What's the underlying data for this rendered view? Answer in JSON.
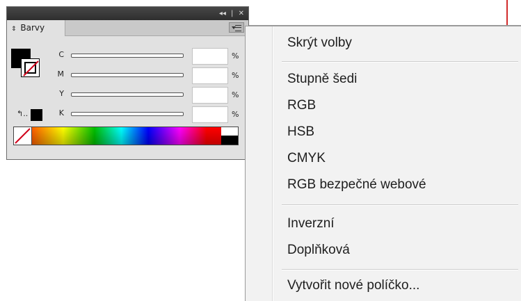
{
  "panel": {
    "tab_label": "Barvy",
    "titlebar_buttons": [
      "◂◂",
      "|",
      "✕"
    ],
    "channels": [
      {
        "label": "C",
        "value": "",
        "unit": "%"
      },
      {
        "label": "M",
        "value": "",
        "unit": "%"
      },
      {
        "label": "Y",
        "value": "",
        "unit": "%"
      },
      {
        "label": "K",
        "value": "",
        "unit": "%"
      }
    ],
    "fill_color": "#000000",
    "icons": [
      "collapse-icon",
      "close-icon",
      "panel-menu-icon",
      "swap-arrow-icon"
    ]
  },
  "menu": {
    "items": [
      "Skrýt volby",
      "Stupně šedi",
      "RGB",
      "HSB",
      "CMYK",
      "RGB bezpečné webové",
      "Inverzní",
      "Doplňková",
      "Vytvořit nové políčko..."
    ]
  }
}
